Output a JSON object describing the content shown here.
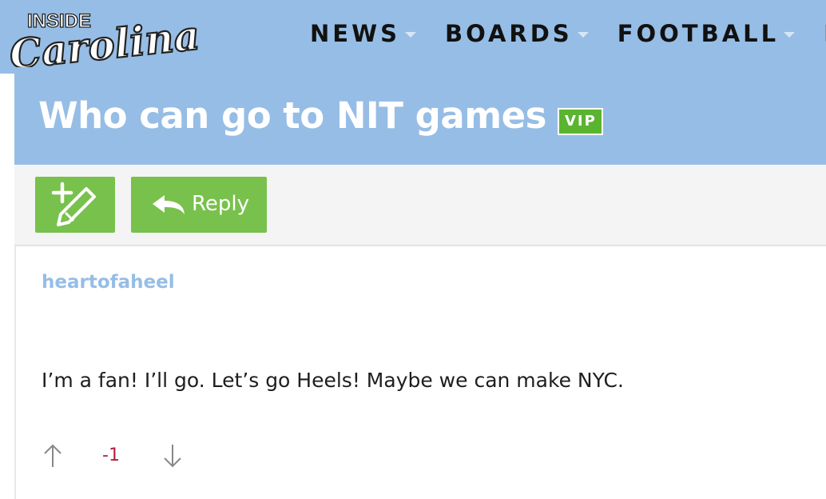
{
  "brand": {
    "logo_top": "INSIDE",
    "logo_bottom": "Carolina"
  },
  "nav": {
    "items": [
      {
        "label": "NEWS"
      },
      {
        "label": "BOARDS"
      },
      {
        "label": "FOOTBALL"
      },
      {
        "label": "FE"
      }
    ]
  },
  "thread": {
    "title": "Who can go to NIT games",
    "badge": "VIP"
  },
  "toolbar": {
    "new_post_icon": "pencil-plus-icon",
    "reply_icon": "reply-arrow-icon",
    "reply_label": "Reply"
  },
  "post": {
    "author": "heartofaheel",
    "body": "I’m a fan! I’ll go. Let’s go Heels! Maybe we can make NYC.",
    "score": "-1"
  },
  "colors": {
    "header_bg": "#96bde5",
    "button_green": "#78c14c",
    "badge_green": "#5ab430",
    "score_red": "#b02038"
  }
}
